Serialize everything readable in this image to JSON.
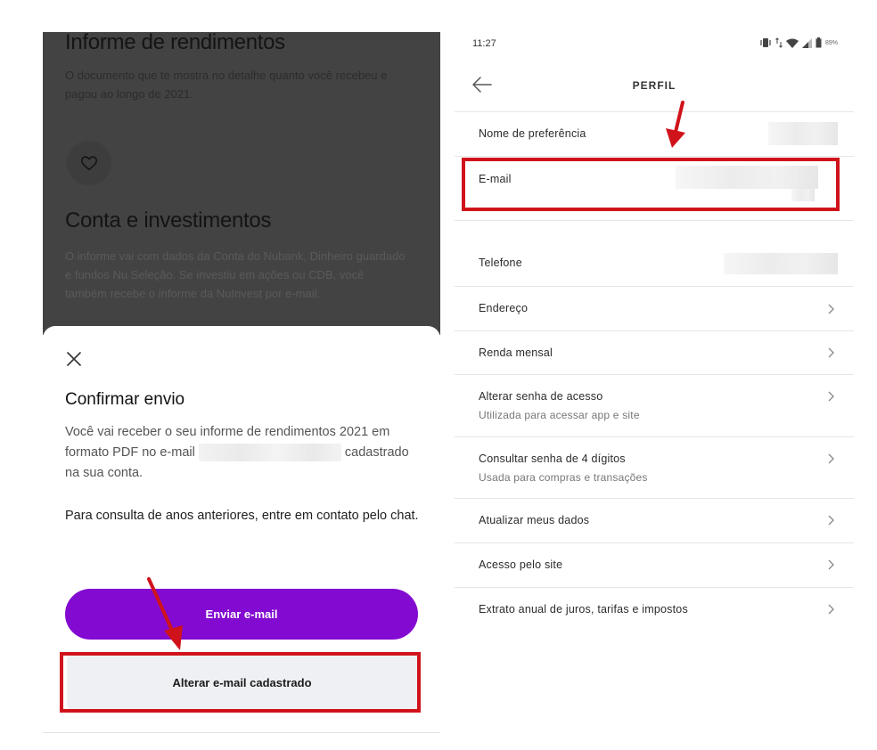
{
  "left": {
    "background_sections": [
      {
        "title": "Informe de rendimentos",
        "body": "O documento que te mostra no detalhe quanto você recebeu e pagou ao longo de 2021."
      },
      {
        "title": "Conta e investimentos",
        "body": "O informe vai com dados da Conta do Nubank, Dinheiro guardado e fundos Nu Seleção. Se investiu em ações ou CDB, você também recebe o informe da NuInvest por e-mail."
      }
    ],
    "favorite_icon": "heart-icon",
    "sheet": {
      "close_icon": "close-icon",
      "title": "Confirmar envio",
      "description_start": "Você vai receber o seu informe de rendimentos 2021 em formato PDF no e-mail",
      "description_end": "cadastrado na sua conta.",
      "note": "Para consulta de anos anteriores, entre em contato pelo chat.",
      "primary_button": "Enviar e-mail",
      "secondary_button": "Alterar e-mail cadastrado"
    }
  },
  "right": {
    "status_bar": {
      "time": "11:27",
      "battery": "89%"
    },
    "header": {
      "title": "PERFIL",
      "back_icon": "arrow-left-icon"
    },
    "rows": [
      {
        "label": "Nome de preferência"
      },
      {
        "label": "E-mail"
      },
      {
        "label": "Telefone"
      },
      {
        "label": "Endereço"
      },
      {
        "label": "Renda mensal"
      },
      {
        "label": "Alterar senha de acesso",
        "sublabel": "Utilizada para acessar app e site"
      },
      {
        "label": "Consultar senha de 4 dígitos",
        "sublabel": "Usada para compras e transações"
      },
      {
        "label": "Atualizar meus dados"
      },
      {
        "label": "Acesso pelo site"
      },
      {
        "label": "Extrato anual de juros, tarifas e impostos"
      }
    ]
  },
  "colors": {
    "brand_purple": "#820ad1",
    "highlight_red": "#d0131b",
    "overlay_dark": "#434343"
  }
}
